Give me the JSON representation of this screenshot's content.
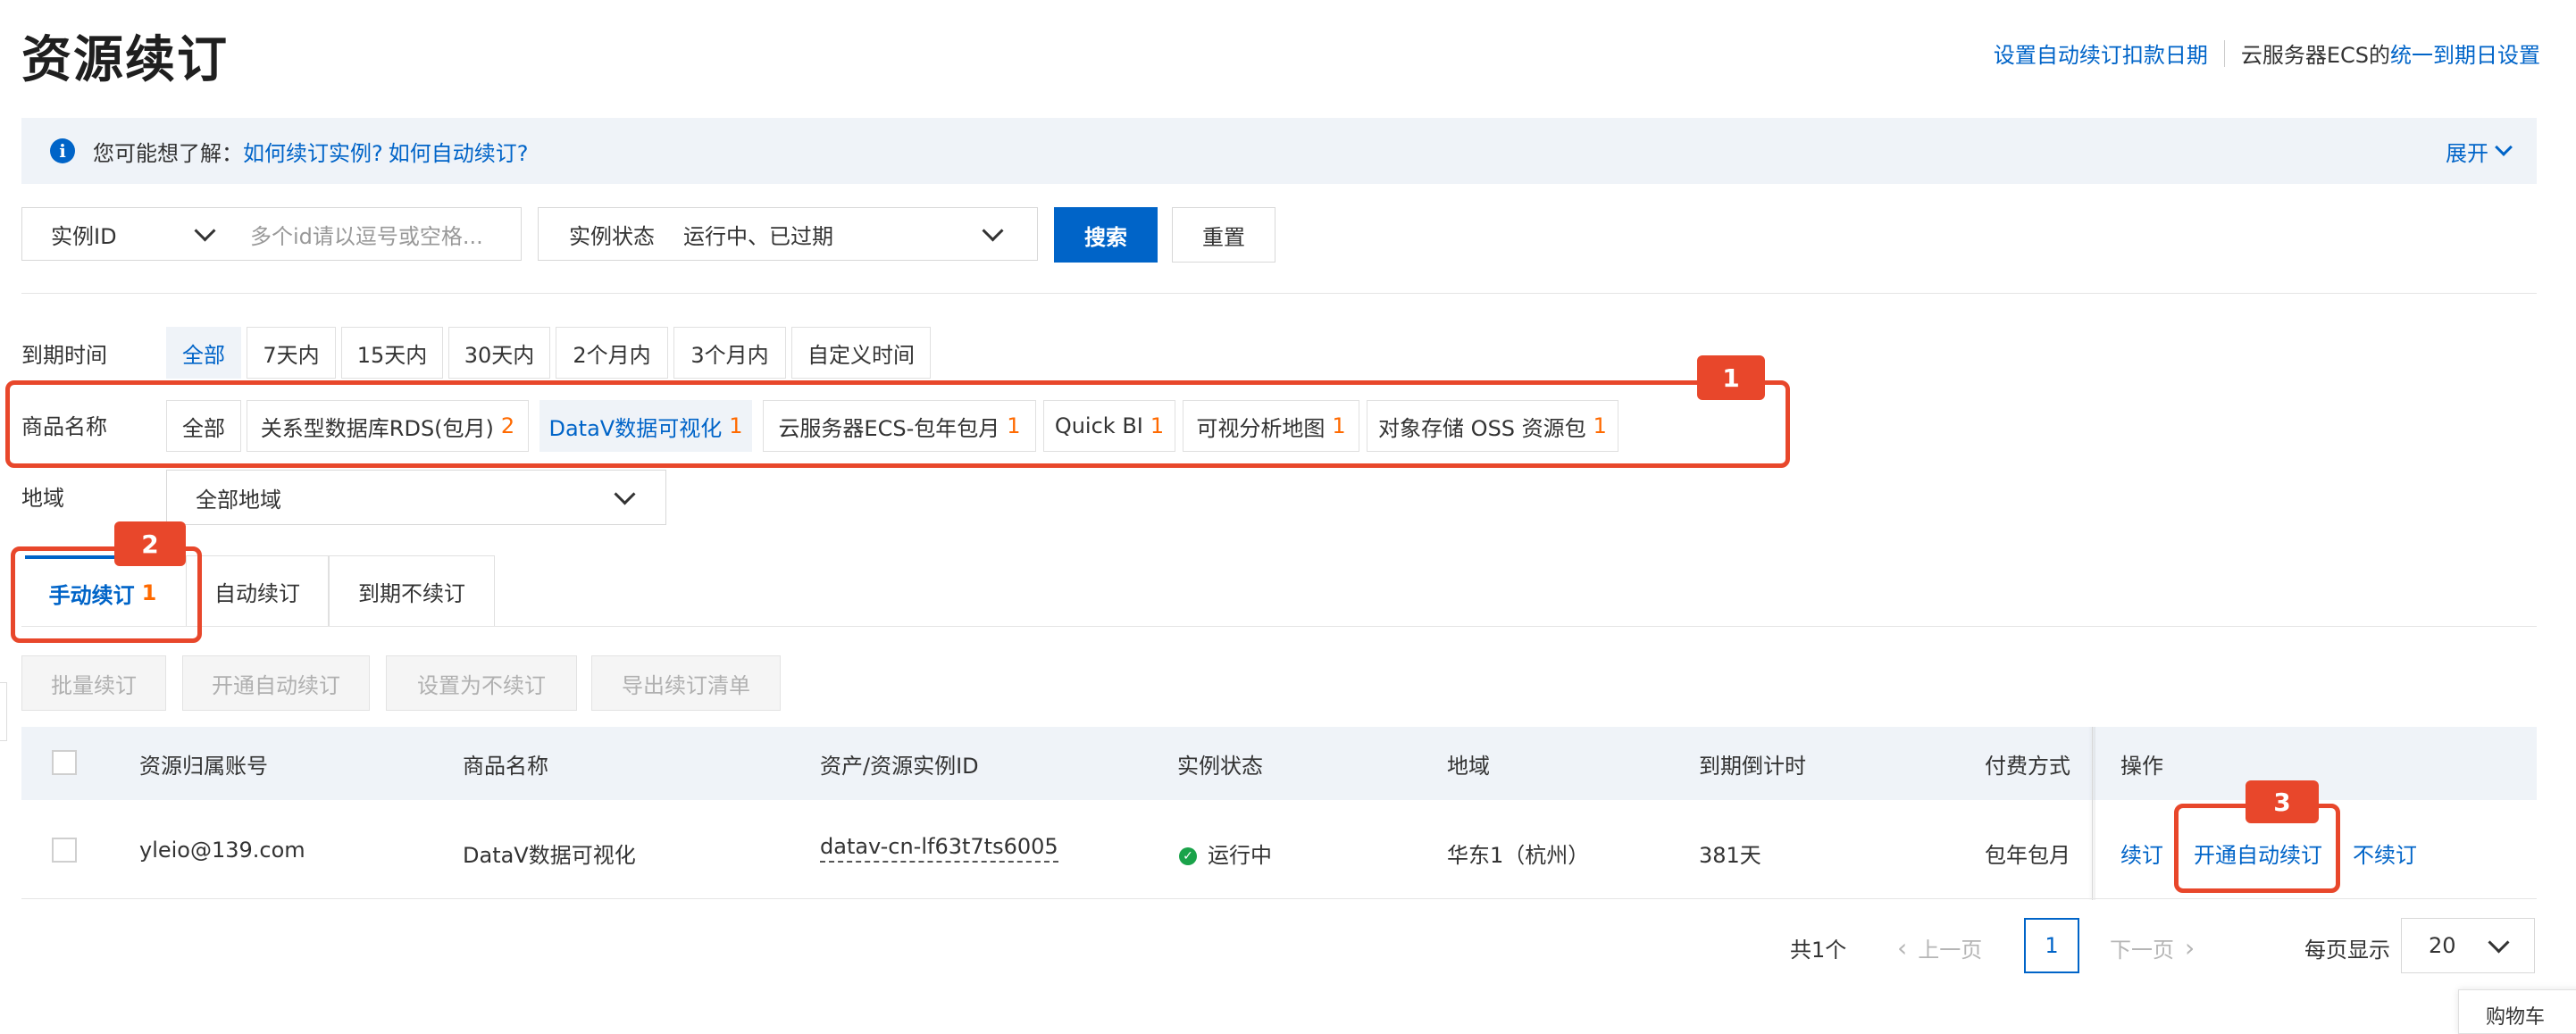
{
  "page": {
    "title": "资源续订"
  },
  "header_links": {
    "auto_deduct_date": "设置自动续订扣款日期",
    "ecs_prefix": "云服务器ECS的",
    "ecs_unify": "统一到期日设置"
  },
  "info_bar": {
    "prefix": "您可能想了解：",
    "link1": "如何续订实例?",
    "link2": "如何自动续订?",
    "expand": "展开"
  },
  "search": {
    "id_select": "实例ID",
    "id_placeholder": "多个id请以逗号或空格...",
    "status_label": "实例状态",
    "status_value": "运行中、已过期",
    "search_button": "搜索",
    "reset_button": "重置"
  },
  "filters": {
    "expire_label": "到期时间",
    "expire_options": [
      "全部",
      "7天内",
      "15天内",
      "30天内",
      "2个月内",
      "3个月内",
      "自定义时间"
    ],
    "product_label": "商品名称",
    "product_options": [
      {
        "name": "全部",
        "count": ""
      },
      {
        "name": "关系型数据库RDS(包月)",
        "count": "2"
      },
      {
        "name": "DataV数据可视化",
        "count": "1"
      },
      {
        "name": "云服务器ECS-包年包月",
        "count": "1"
      },
      {
        "name": "Quick BI",
        "count": "1"
      },
      {
        "name": "可视分析地图",
        "count": "1"
      },
      {
        "name": "对象存储 OSS 资源包",
        "count": "1"
      }
    ],
    "region_label": "地域",
    "region_value": "全部地域"
  },
  "annotations": {
    "badge1": "1",
    "badge2": "2",
    "badge3": "3"
  },
  "tabs": [
    {
      "label": "手动续订",
      "count": "1"
    },
    {
      "label": "自动续订",
      "count": ""
    },
    {
      "label": "到期不续订",
      "count": ""
    }
  ],
  "actions": [
    "批量续订",
    "开通自动续订",
    "设置为不续订",
    "导出续订清单"
  ],
  "table": {
    "columns": [
      "资源归属账号",
      "商品名称",
      "资产/资源实例ID",
      "实例状态",
      "地域",
      "到期倒计时",
      "付费方式",
      "操作"
    ],
    "rows": [
      {
        "account": "yleio@139.com",
        "product": "DataV数据可视化",
        "instance_id": "datav-cn-lf63t7ts6005",
        "status": "运行中",
        "region": "华东1（杭州）",
        "countdown": "381天",
        "billing": "包年包月",
        "op_renew": "续订",
        "op_auto": "开通自动续订",
        "op_no": "不续订"
      }
    ]
  },
  "pagination": {
    "total": "共1个",
    "prev": "上一页",
    "current": "1",
    "next": "下一页",
    "per_page_label": "每页显示",
    "per_page_value": "20"
  },
  "cart": {
    "label": "购物车"
  },
  "colors": {
    "accent": "#0064c8",
    "annotation_red": "#e8472b",
    "count_orange": "#ff6a00",
    "success_green": "#1aa34a"
  }
}
